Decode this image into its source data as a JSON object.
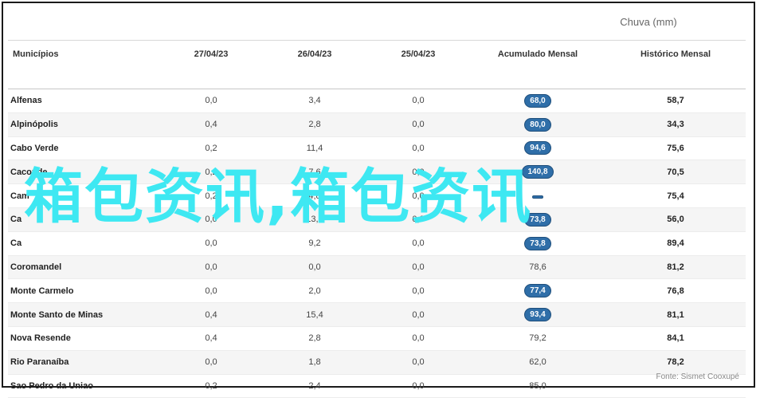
{
  "header_group": "Chuva (mm)",
  "columns": [
    "Municípios",
    "27/04/23",
    "26/04/23",
    "25/04/23",
    "Acumulado Mensal",
    "Histórico Mensal"
  ],
  "rows": [
    {
      "name": "Alfenas",
      "d1": "0,0",
      "d2": "3,4",
      "d3": "0,0",
      "acc": "68,0",
      "acc_badge": true,
      "hist": "58,7"
    },
    {
      "name": "Alpinópolis",
      "d1": "0,4",
      "d2": "2,8",
      "d3": "0,0",
      "acc": "80,0",
      "acc_badge": true,
      "hist": "34,3"
    },
    {
      "name": "Cabo Verde",
      "d1": "0,2",
      "d2": "11,4",
      "d3": "0,0",
      "acc": "94,6",
      "acc_badge": true,
      "hist": "75,6"
    },
    {
      "name": "Caconde",
      "d1": "0,2",
      "d2": "7,6",
      "d3": "0,0",
      "acc": "140,8",
      "acc_badge": true,
      "hist": "70,5"
    },
    {
      "name": "Cam",
      "d1": "0,2",
      "d2": "4,8",
      "d3": "0,0",
      "acc": "",
      "acc_badge": true,
      "hist": "75,4"
    },
    {
      "name": "Ca",
      "d1": "0,0",
      "d2": "13,0",
      "d3": "0,0",
      "acc": "73,8",
      "acc_badge": true,
      "hist": "56,0"
    },
    {
      "name": "Ca",
      "d1": "0,0",
      "d2": "9,2",
      "d3": "0,0",
      "acc": "73,8",
      "acc_badge": true,
      "hist": "89,4"
    },
    {
      "name": "Coromandel",
      "d1": "0,0",
      "d2": "0,0",
      "d3": "0,0",
      "acc": "78,6",
      "acc_badge": false,
      "hist": "81,2"
    },
    {
      "name": "Monte Carmelo",
      "d1": "0,0",
      "d2": "2,0",
      "d3": "0,0",
      "acc": "77,4",
      "acc_badge": true,
      "hist": "76,8"
    },
    {
      "name": "Monte Santo de Minas",
      "d1": "0,4",
      "d2": "15,4",
      "d3": "0,0",
      "acc": "93,4",
      "acc_badge": true,
      "hist": "81,1"
    },
    {
      "name": "Nova Resende",
      "d1": "0,4",
      "d2": "2,8",
      "d3": "0,0",
      "acc": "79,2",
      "acc_badge": false,
      "hist": "84,1"
    },
    {
      "name": "Rio Paranaíba",
      "d1": "0,0",
      "d2": "1,8",
      "d3": "0,0",
      "acc": "62,0",
      "acc_badge": false,
      "hist": "78,2"
    },
    {
      "name": "Sao Pedro da Uniao",
      "d1": "0,2",
      "d2": "2,4",
      "d3": "0,0",
      "acc": "85,0",
      "acc_badge": false,
      "hist": ""
    }
  ],
  "source": "Fonte: Sismet Cooxupé",
  "overlay_text": "箱包资讯,箱包资讯",
  "colors": {
    "badge": "#2f6ea8",
    "overlay": "#3ee8f2"
  }
}
